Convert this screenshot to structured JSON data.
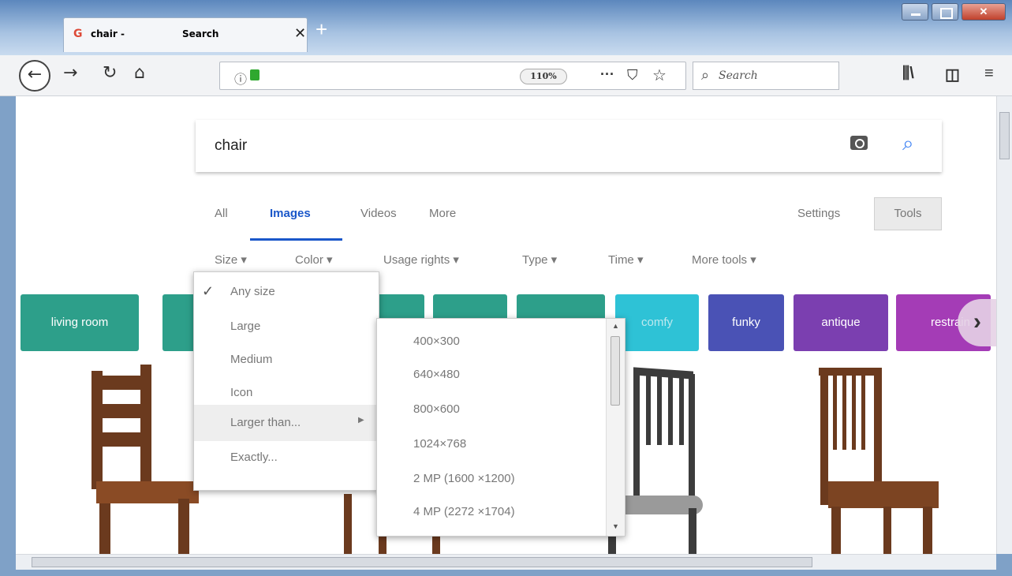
{
  "browser": {
    "tab_title_part1": "chair -",
    "tab_title_part2": "Search",
    "tab_icon": "G",
    "zoom": "110%",
    "search_placeholder": "Search",
    "colors": {
      "frame": "#7fa1c7",
      "close": "#c0412c"
    }
  },
  "google": {
    "query": "chair",
    "tabs": [
      "All",
      "Images",
      "Videos",
      "More"
    ],
    "active_tab": "Images",
    "settings": "Settings",
    "tools": "Tools",
    "filters": [
      "Size ▾",
      "Color ▾",
      "Usage rights ▾",
      "Type ▾",
      "Time ▾",
      "More tools ▾"
    ],
    "chips": [
      {
        "label": "living room",
        "color": "#2d9f8a"
      },
      {
        "label": "",
        "color": "#2d9f8a"
      },
      {
        "label": "",
        "color": "#2d9f8a"
      },
      {
        "label": "",
        "color": "#2d9f8a"
      },
      {
        "label": "",
        "color": "#2d9f8a"
      },
      {
        "label": "comfy",
        "color": "#2ec2d6"
      },
      {
        "label": "funky",
        "color": "#4a52b5"
      },
      {
        "label": "antique",
        "color": "#7b3fb0"
      },
      {
        "label": "restrain",
        "color": "#a43cb6"
      }
    ],
    "size_menu": {
      "items": [
        "Any size",
        "Large",
        "Medium",
        "Icon",
        "Larger than...",
        "Exactly..."
      ],
      "checked": "Any size"
    },
    "larger_than_menu": {
      "items": [
        "400×300",
        "640×480",
        "800×600",
        "1024×768",
        "2 MP (1600 ×1200)",
        "4 MP (2272 ×1704)"
      ]
    }
  }
}
